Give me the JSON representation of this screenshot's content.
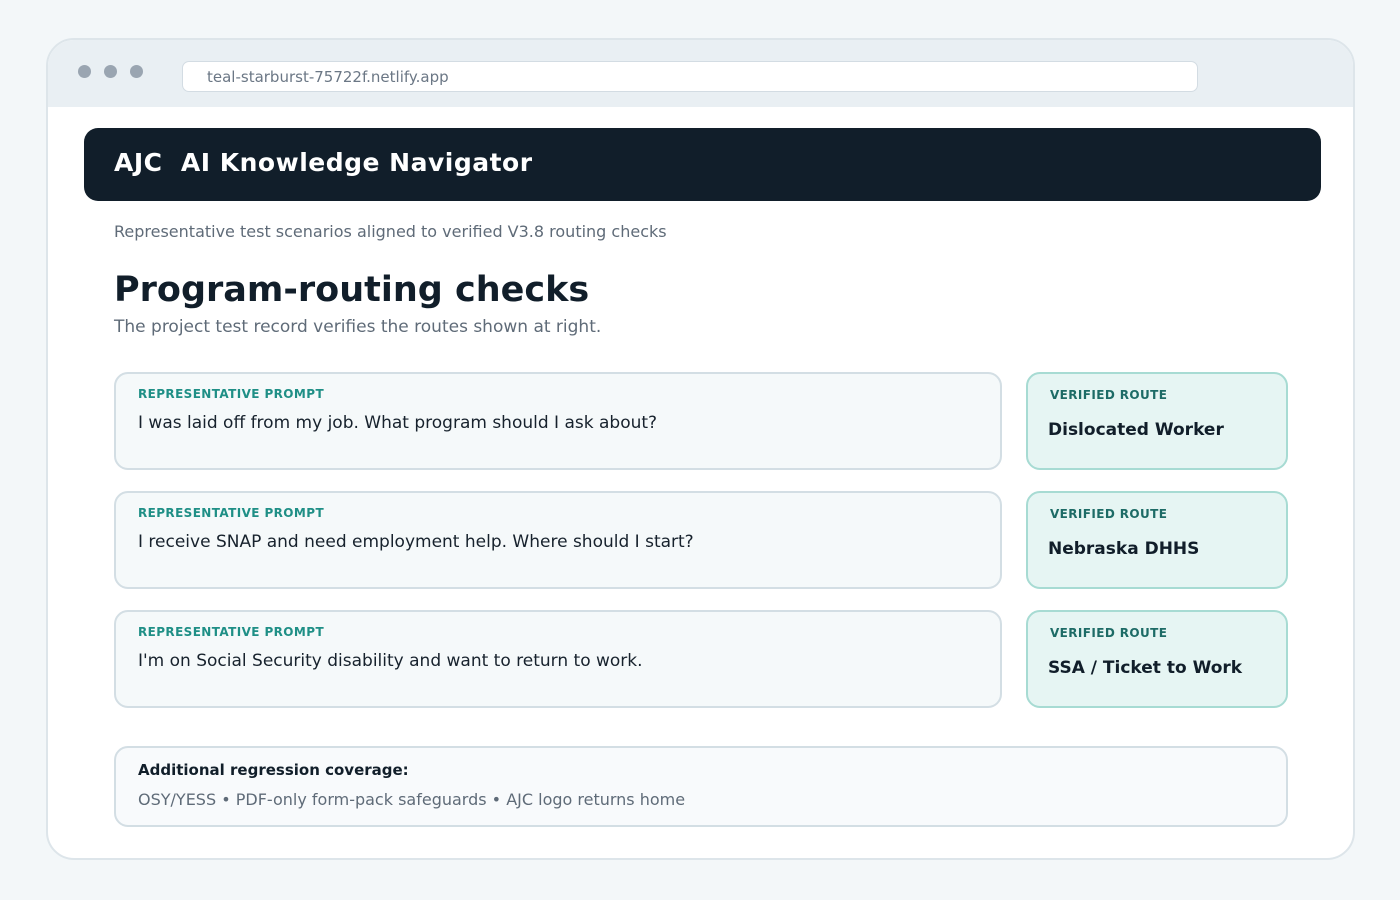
{
  "browser": {
    "url": "teal-starburst-75722f.netlify.app"
  },
  "header": {
    "brand": "AJC  AI Knowledge Navigator"
  },
  "subtitle": "Representative test scenarios aligned to verified V3.8 routing checks",
  "section": {
    "title": "Program-routing checks",
    "description": "The project test record verifies the routes shown at right."
  },
  "checks": [
    {
      "prompt_label": "REPRESENTATIVE PROMPT",
      "prompt": "I was laid off from my job. What program should I ask about?",
      "route_label": "VERIFIED ROUTE",
      "route": "Dislocated Worker"
    },
    {
      "prompt_label": "REPRESENTATIVE PROMPT",
      "prompt": "I receive SNAP and need employment help. Where should I start?",
      "route_label": "VERIFIED ROUTE",
      "route": "Nebraska DHHS"
    },
    {
      "prompt_label": "REPRESENTATIVE PROMPT",
      "prompt": "I'm on Social Security disability and want to return to work.",
      "route_label": "VERIFIED ROUTE",
      "route": "SSA / Ticket to Work"
    }
  ],
  "coverage": {
    "title": "Additional regression coverage:",
    "items": "OSY/YESS • PDF-only form-pack safeguards • AJC logo returns home"
  },
  "colors": {
    "header_bg": "#111e2a",
    "accent_teal": "#1f8f86",
    "route_bg": "#e6f5f3"
  }
}
